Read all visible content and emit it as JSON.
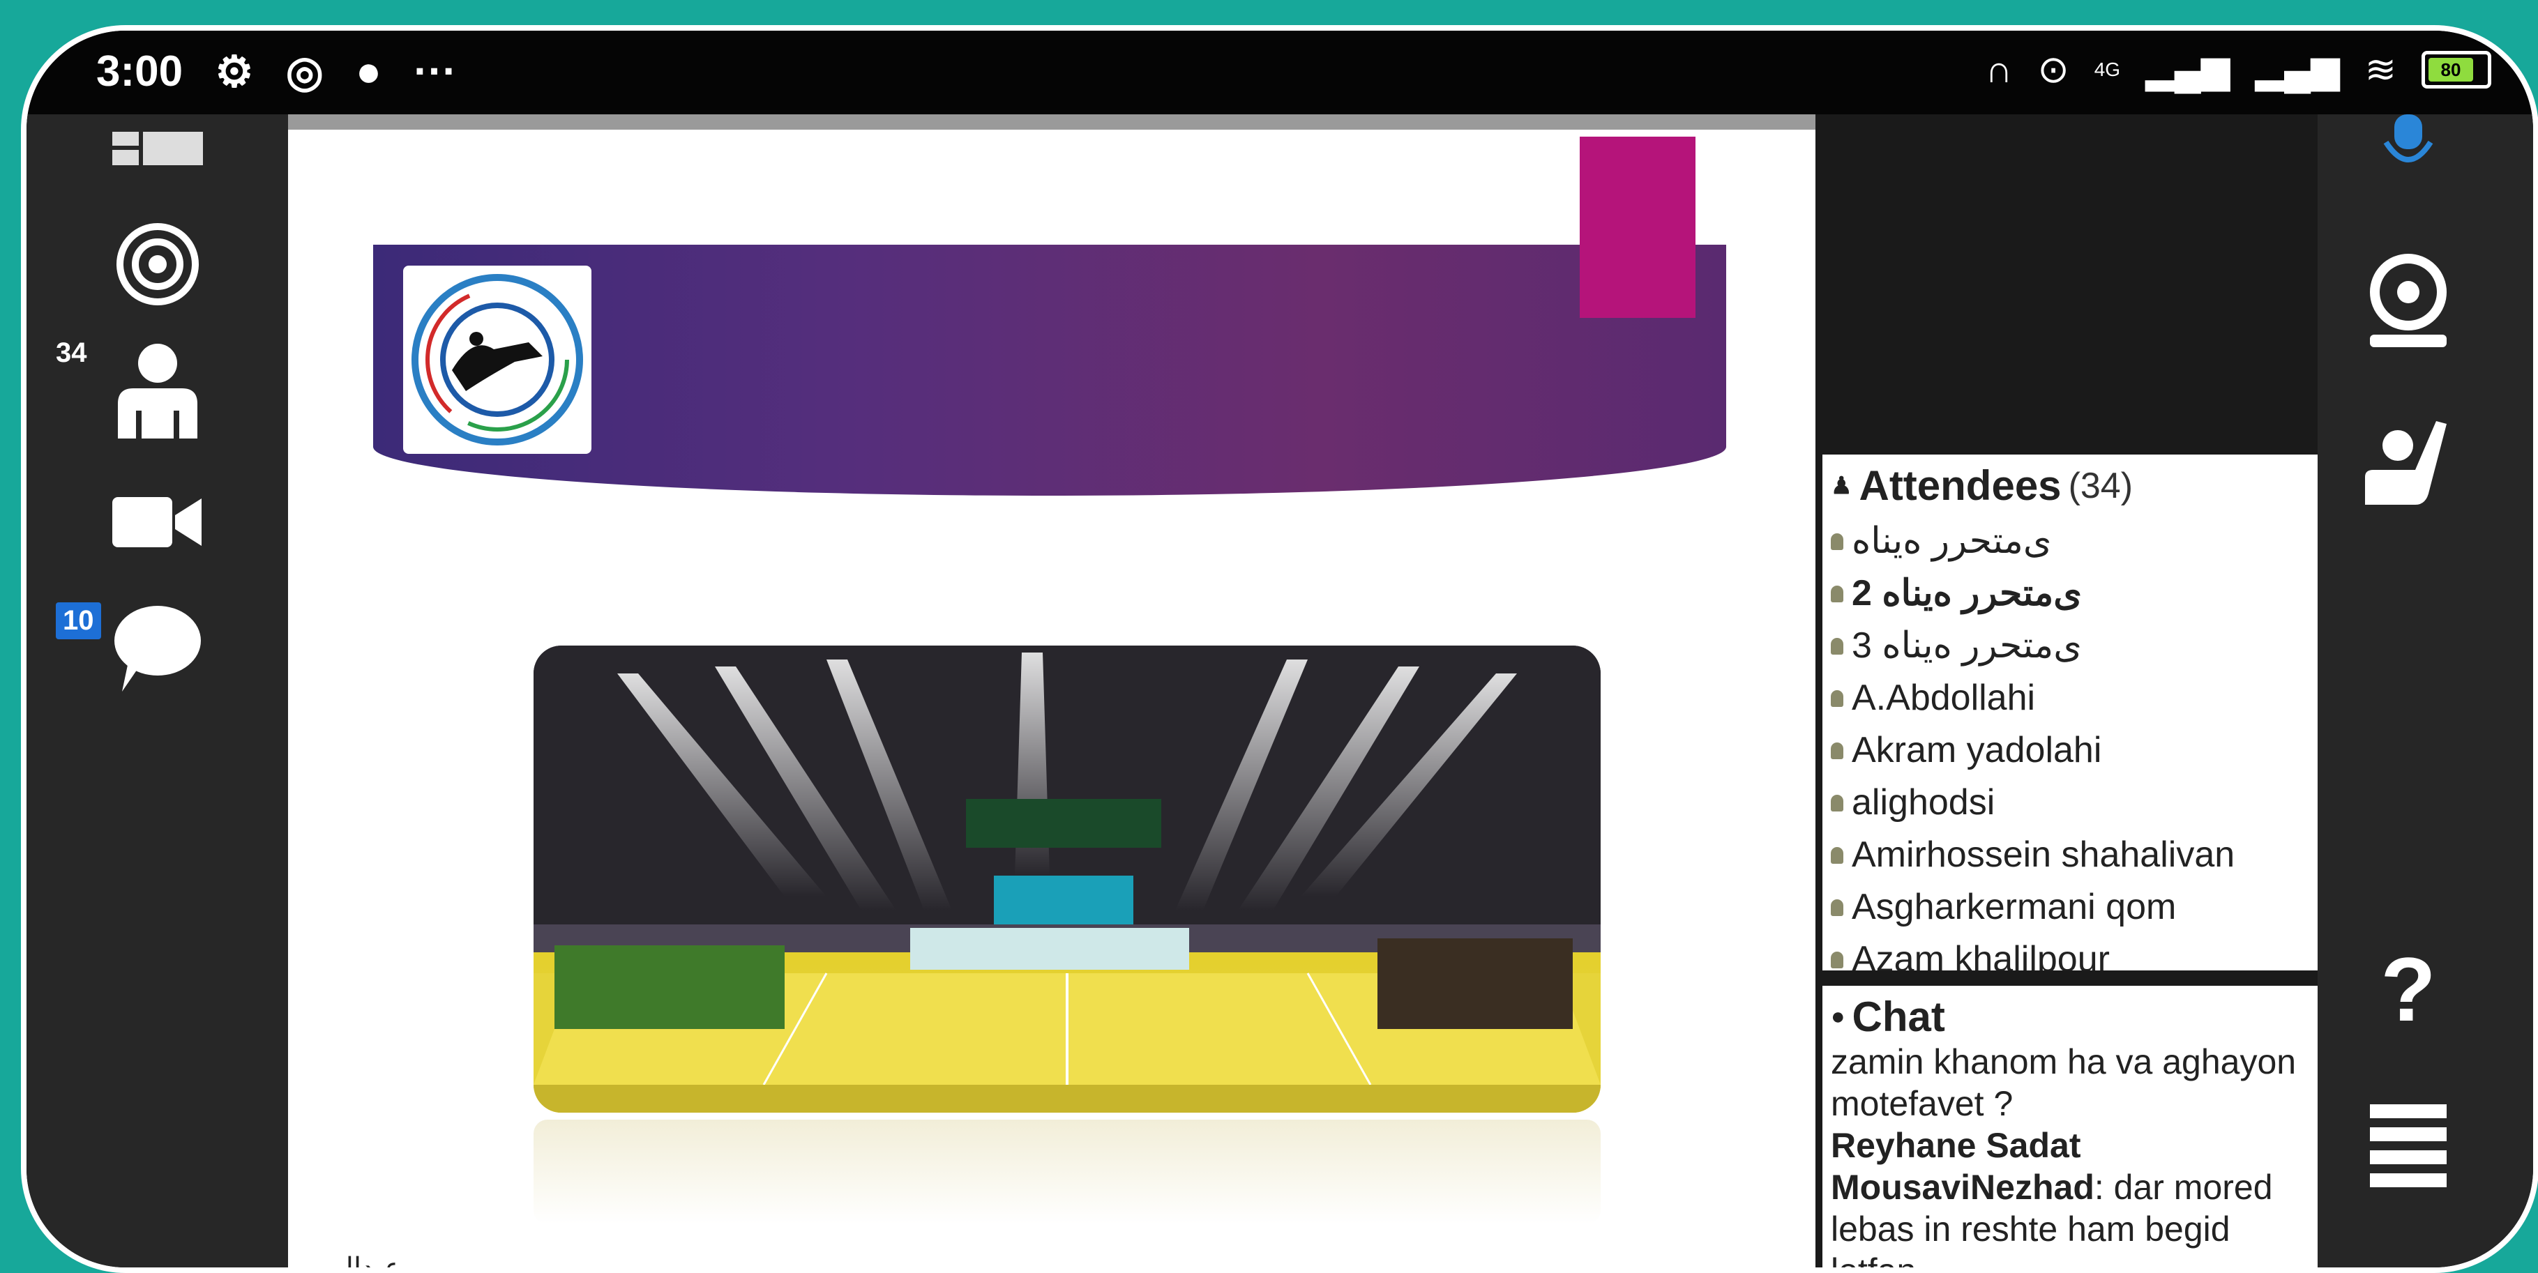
{
  "status_bar": {
    "time": "3:00",
    "more": "···",
    "battery": "80",
    "network": "4G"
  },
  "left_toolbar": {
    "attendees_count": "34",
    "chat_unread": "10"
  },
  "slide": {
    "footer_text": "عبدالهي"
  },
  "attendees": {
    "title": "Attendees",
    "count": "(34)",
    "items": [
      "ی‌متحرر ه‌یناه",
      "ی‌متحرر ه‌یناه 2",
      "ی‌متحرر ه‌یناه 3",
      "A.Abdollahi",
      "Akram yadolahi",
      "alighodsi",
      "Amirhossein shahalivan",
      "Asgharkermani qom",
      "Azam khalilpour"
    ]
  },
  "chat": {
    "title": "Chat",
    "line1": "zamin khanom ha va aghayon motefavet ?",
    "sender": "Reyhane Sadat MousaviNezhad",
    "message": ": dar mored lebas in reshte ham begid lotfan"
  },
  "right_toolbar": {
    "help_label": "?"
  },
  "colors": {
    "background": "#17a89a",
    "banner": "#552e7c",
    "accent_pink": "#b5147a",
    "badge_blue": "#1d6fd6"
  }
}
